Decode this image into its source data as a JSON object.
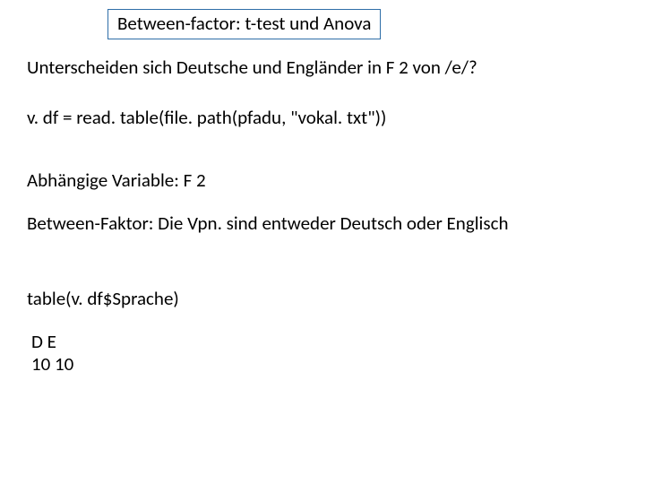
{
  "title": "Between-factor: t-test und Anova",
  "question": "Unterscheiden sich Deutsche und Engländer in F 2 von /e/?",
  "code_read": "v. df = read. table(file. path(pfadu, \"vokal. txt\"))",
  "dependent": "Abhängige Variable: F 2",
  "between": "Between-Faktor: Die Vpn. sind entweder Deutsch oder Englisch",
  "code_table": "table(v. df$Sprache)",
  "output_header": "D  E",
  "output_values": "10 10"
}
